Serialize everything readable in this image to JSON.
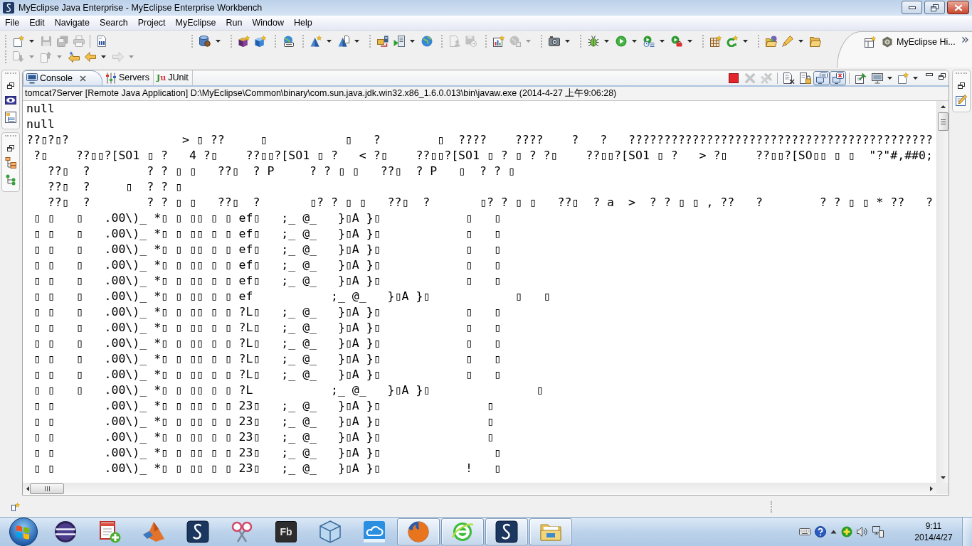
{
  "window": {
    "title": "MyEclipse Java Enterprise - MyEclipse Enterprise Workbench"
  },
  "menu": [
    "File",
    "Edit",
    "Navigate",
    "Search",
    "Project",
    "MyEclipse",
    "Run",
    "Window",
    "Help"
  ],
  "toolbar": {
    "rows": [
      {
        "groups": [
          {
            "kind": "grip",
            "items": [
              {
                "kind": "new-wizard",
                "disabled": false,
                "dropdown": true
              },
              {
                "kind": "save",
                "disabled": true,
                "dropdown": false
              },
              {
                "kind": "save-all",
                "disabled": true,
                "dropdown": false
              },
              {
                "kind": "print",
                "disabled": true,
                "dropdown": false
              }
            ]
          },
          {
            "kind": "line",
            "items": [
              {
                "kind": "binary",
                "disabled": false,
                "dropdown": false
              }
            ]
          },
          {
            "kind": "grip",
            "items": [
              {
                "kind": "database",
                "disabled": false,
                "dropdown": true
              }
            ]
          },
          {
            "kind": "grip",
            "items": [
              {
                "kind": "cube-dark",
                "disabled": false,
                "dropdown": false
              },
              {
                "kind": "cube-light",
                "disabled": false,
                "dropdown": false
              }
            ]
          },
          {
            "kind": "grip",
            "items": [
              {
                "kind": "web-badge",
                "disabled": false,
                "dropdown": false
              }
            ]
          },
          {
            "kind": "grip",
            "items": [
              {
                "kind": "pyramid-star",
                "disabled": false,
                "dropdown": true
              },
              {
                "kind": "pyramid-page",
                "disabled": false,
                "dropdown": true
              }
            ]
          },
          {
            "kind": "grip",
            "items": [
              {
                "kind": "deploy",
                "disabled": false,
                "dropdown": false
              },
              {
                "kind": "run-server",
                "disabled": false,
                "dropdown": true
              },
              {
                "kind": "globe",
                "disabled": false,
                "dropdown": false
              }
            ]
          },
          {
            "kind": "grip",
            "items": [
              {
                "kind": "page-person",
                "disabled": true,
                "dropdown": false
              },
              {
                "kind": "disk-arrow",
                "disabled": true,
                "dropdown": false
              }
            ]
          },
          {
            "kind": "grip",
            "items": [
              {
                "kind": "report",
                "disabled": false,
                "dropdown": false
              },
              {
                "kind": "globe-badge",
                "disabled": true,
                "dropdown": true
              }
            ]
          },
          {
            "kind": "grip",
            "items": [
              {
                "kind": "camera",
                "disabled": false,
                "dropdown": true
              }
            ]
          },
          {
            "kind": "grip",
            "items": [
              {
                "kind": "bug",
                "disabled": false,
                "dropdown": true
              },
              {
                "kind": "run",
                "disabled": false,
                "dropdown": true
              },
              {
                "kind": "run-history",
                "disabled": false,
                "dropdown": true
              },
              {
                "kind": "run-tools",
                "disabled": false,
                "dropdown": true
              }
            ]
          },
          {
            "kind": "grip",
            "items": [
              {
                "kind": "grid-star",
                "disabled": false,
                "dropdown": false
              },
              {
                "kind": "c-star",
                "disabled": false,
                "dropdown": true
              }
            ]
          },
          {
            "kind": "grip",
            "items": [
              {
                "kind": "folder-ball",
                "disabled": false,
                "dropdown": false
              },
              {
                "kind": "pencil",
                "disabled": false,
                "dropdown": true
              },
              {
                "kind": "folder-open",
                "disabled": false,
                "dropdown": false
              }
            ]
          }
        ]
      },
      {
        "groups": [
          {
            "kind": "grip",
            "items": [
              {
                "kind": "next-annotation",
                "disabled": true,
                "dropdown": true
              },
              {
                "kind": "prev-annotation",
                "disabled": true,
                "dropdown": true
              },
              {
                "kind": "last-edit",
                "disabled": false,
                "dropdown": false
              },
              {
                "kind": "back",
                "disabled": false,
                "dropdown": true
              },
              {
                "kind": "forward",
                "disabled": true,
                "dropdown": true
              }
            ]
          }
        ]
      }
    ]
  },
  "perspective_bar": {
    "label": "MyEclipse Hi..."
  },
  "console_view": {
    "tabs": [
      {
        "kind": "console",
        "label": "Console",
        "selected": true,
        "closable": true
      },
      {
        "kind": "servers",
        "label": "Servers",
        "selected": false,
        "closable": false
      },
      {
        "kind": "junit",
        "icon_text": "Ju",
        "label": "JUnit",
        "selected": false,
        "closable": false
      }
    ],
    "toolbar": [
      {
        "items": [
          {
            "kind": "terminate",
            "disabled": false,
            "pressed": false,
            "dropdown": false
          },
          {
            "kind": "remove",
            "disabled": true,
            "pressed": false,
            "dropdown": false
          },
          {
            "kind": "remove-all",
            "disabled": true,
            "pressed": false,
            "dropdown": false
          }
        ]
      },
      {
        "items": [
          {
            "kind": "clear",
            "disabled": false,
            "pressed": false,
            "dropdown": false
          },
          {
            "kind": "scroll-lock",
            "disabled": false,
            "pressed": false,
            "dropdown": false
          },
          {
            "kind": "show-out",
            "disabled": false,
            "pressed": true,
            "dropdown": false
          },
          {
            "kind": "show-err",
            "disabled": false,
            "pressed": true,
            "dropdown": false
          }
        ]
      },
      {
        "items": [
          {
            "kind": "pin",
            "disabled": false,
            "pressed": false,
            "dropdown": false
          },
          {
            "kind": "display",
            "disabled": false,
            "pressed": false,
            "dropdown": true
          },
          {
            "kind": "open-console",
            "disabled": false,
            "pressed": false,
            "dropdown": true
          }
        ]
      }
    ],
    "process_label": "tomcat7Server [Remote Java Application] D:\\MyEclipse\\Common\\binary\\com.sun.java.jdk.win32.x86_1.6.0.013\\bin\\javaw.exe (2014-4-27 上午9:06:28)",
    "lines": [
      "null",
      "null",
      "??▯?▯?                > ▯ ??     ▯           ▯   ?        ▯  ????    ????    ?   ?   ???????????????????????????????????????????",
      " ?▯    ??▯▯?[SO1 ▯ ?   4 ?▯    ??▯▯?[SO1 ▯ ?   < ?▯    ??▯▯?[SO1 ▯ ? ▯ ? ?▯    ??▯▯?[SO1 ▯ ?   > ?▯    ??▯▯?[SO▯▯ ▯ ▯  \"?\"#,##0;",
      "   ??▯  ?        ? ? ▯ ▯   ??▯  ? P     ? ? ▯ ▯   ??▯  ? P   ▯  ? ? ▯",
      "   ??▯  ?     ▯  ? ? ▯",
      "   ??▯  ?        ? ? ▯ ▯   ??▯  ?       ▯? ? ▯ ▯   ??▯  ?       ▯? ? ▯ ▯   ??▯  ? a  >  ? ? ▯ ▯ , ??   ?        ? ? ▯ ▯ * ??   ?",
      " ▯ ▯   ▯   .00\\)_ *▯ ▯ ▯▯ ▯ ▯ ef▯   ;_ @_   }▯A }▯            ▯   ▯",
      " ▯ ▯   ▯   .00\\)_ *▯ ▯ ▯▯ ▯ ▯ ef▯   ;_ @_   }▯A }▯            ▯   ▯",
      " ▯ ▯   ▯   .00\\)_ *▯ ▯ ▯▯ ▯ ▯ ef▯   ;_ @_   }▯A }▯            ▯   ▯",
      " ▯ ▯   ▯   .00\\)_ *▯ ▯ ▯▯ ▯ ▯ ef▯   ;_ @_   }▯A }▯            ▯   ▯",
      " ▯ ▯   ▯   .00\\)_ *▯ ▯ ▯▯ ▯ ▯ ef▯   ;_ @_   }▯A }▯            ▯   ▯",
      " ▯ ▯   ▯   .00\\)_ *▯ ▯ ▯▯ ▯ ▯ ef           ;_ @_   }▯A }▯            ▯   ▯",
      " ▯ ▯   ▯   .00\\)_ *▯ ▯ ▯▯ ▯ ▯ ?L▯   ;_ @_   }▯A }▯            ▯   ▯",
      " ▯ ▯   ▯   .00\\)_ *▯ ▯ ▯▯ ▯ ▯ ?L▯   ;_ @_   }▯A }▯            ▯   ▯",
      " ▯ ▯   ▯   .00\\)_ *▯ ▯ ▯▯ ▯ ▯ ?L▯   ;_ @_   }▯A }▯            ▯   ▯",
      " ▯ ▯   ▯   .00\\)_ *▯ ▯ ▯▯ ▯ ▯ ?L▯   ;_ @_   }▯A }▯            ▯   ▯",
      " ▯ ▯   ▯   .00\\)_ *▯ ▯ ▯▯ ▯ ▯ ?L▯   ;_ @_   }▯A }▯            ▯   ▯",
      " ▯ ▯   ▯   .00\\)_ *▯ ▯ ▯▯ ▯ ▯ ?L           ;_ @_   }▯A }▯               ▯",
      " ▯ ▯       .00\\)_ *▯ ▯ ▯▯ ▯ ▯ 23▯   ;_ @_   }▯A }▯               ▯",
      " ▯ ▯       .00\\)_ *▯ ▯ ▯▯ ▯ ▯ 23▯   ;_ @_   }▯A }▯               ▯",
      " ▯ ▯       .00\\)_ *▯ ▯ ▯▯ ▯ ▯ 23▯   ;_ @_   }▯A }▯               ▯",
      " ▯ ▯       .00\\)_ *▯ ▯ ▯▯ ▯ ▯ 23▯   ;_ @_   }▯A }▯                ▯",
      " ▯ ▯       .00\\)_ *▯ ▯ ▯▯ ▯ ▯ 23▯   ;_ @_   }▯A }▯            !   ▯"
    ]
  },
  "taskbar": {
    "apps": [
      {
        "kind": "eclipse",
        "running": false
      },
      {
        "kind": "notepad-plus",
        "running": false
      },
      {
        "kind": "matlab",
        "running": false
      },
      {
        "kind": "myeclipse",
        "running": false
      },
      {
        "kind": "scissors",
        "running": false
      },
      {
        "kind": "flash-builder",
        "icon_text": "Fb",
        "running": false
      },
      {
        "kind": "cube",
        "running": false
      },
      {
        "kind": "cloud",
        "running": false
      },
      {
        "kind": "firefox",
        "running": true
      },
      {
        "kind": "green-e",
        "running": true
      },
      {
        "kind": "myeclipse",
        "running": true
      },
      {
        "kind": "folder",
        "running": true
      }
    ],
    "clock": {
      "time": "9:11",
      "date": "2014/4/27"
    }
  }
}
